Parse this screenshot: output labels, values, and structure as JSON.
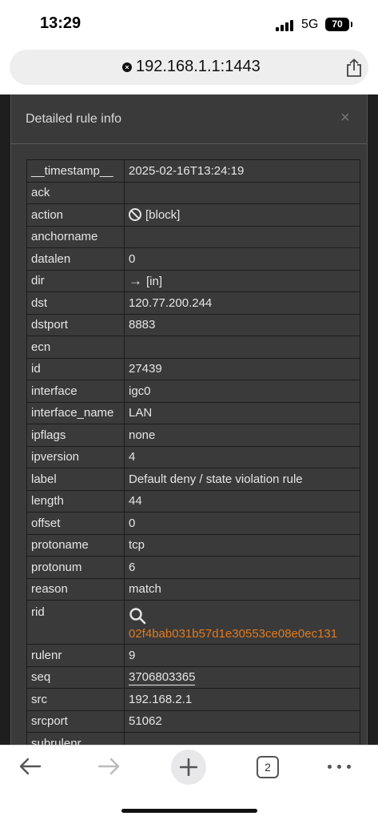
{
  "status": {
    "time": "13:29",
    "network": "5G",
    "battery": "70"
  },
  "browser": {
    "url": "192.168.1.1:1443",
    "tab_count": "2"
  },
  "modal": {
    "title": "Detailed rule info",
    "close_label": "×"
  },
  "rows": [
    {
      "key": "__timestamp__",
      "value": "2025-02-16T13:24:19"
    },
    {
      "key": "ack",
      "value": ""
    },
    {
      "key": "action",
      "value": "[block]",
      "icon": "block-icon"
    },
    {
      "key": "anchorname",
      "value": ""
    },
    {
      "key": "datalen",
      "value": "0"
    },
    {
      "key": "dir",
      "value": "[in]",
      "icon": "arrow-right-icon"
    },
    {
      "key": "dst",
      "value": "120.77.200.244"
    },
    {
      "key": "dstport",
      "value": "8883"
    },
    {
      "key": "ecn",
      "value": ""
    },
    {
      "key": "id",
      "value": "27439"
    },
    {
      "key": "interface",
      "value": "igc0"
    },
    {
      "key": "interface_name",
      "value": "LAN"
    },
    {
      "key": "ipflags",
      "value": "none"
    },
    {
      "key": "ipversion",
      "value": "4"
    },
    {
      "key": "label",
      "value": "Default deny / state violation rule"
    },
    {
      "key": "length",
      "value": "44"
    },
    {
      "key": "offset",
      "value": "0"
    },
    {
      "key": "protoname",
      "value": "tcp"
    },
    {
      "key": "protonum",
      "value": "6"
    },
    {
      "key": "reason",
      "value": "match"
    },
    {
      "key": "rid",
      "value": "02f4bab031b57d1e30553ce08e0ec131",
      "icon": "search-icon"
    },
    {
      "key": "rulenr",
      "value": "9"
    },
    {
      "key": "seq",
      "value": "3706803365"
    },
    {
      "key": "src",
      "value": "192.168.2.1"
    },
    {
      "key": "srcport",
      "value": "51062"
    },
    {
      "key": "subrulenr",
      "value": ""
    }
  ],
  "colors": {
    "link": "#e07a1f",
    "modal_bg": "#3a3a3a",
    "page_bg": "#1e1e1e"
  }
}
